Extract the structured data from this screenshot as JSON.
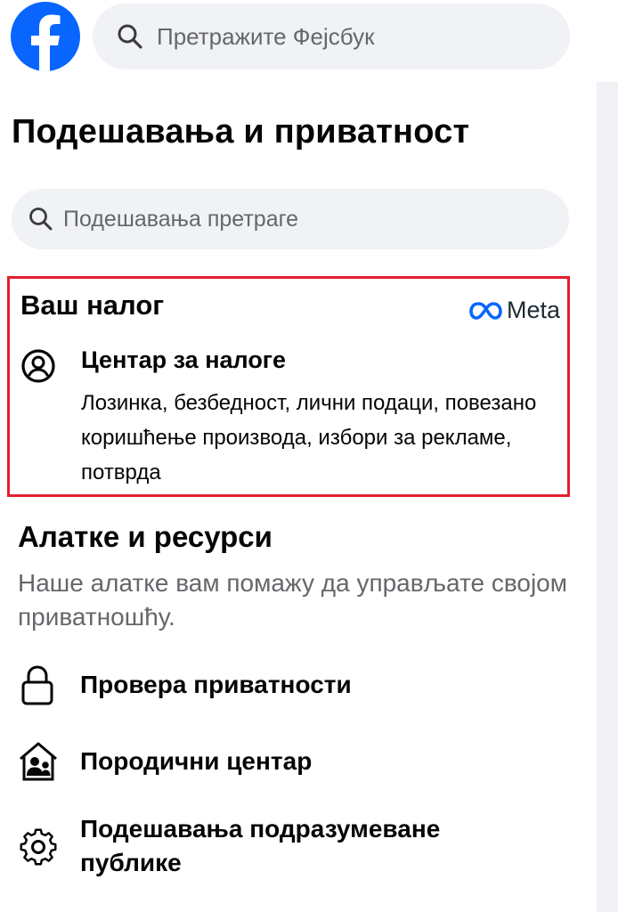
{
  "header": {
    "search_placeholder": "Претражите Фејсбук"
  },
  "page": {
    "title": "Подешавања и приватност",
    "settings_search_placeholder": "Подешавања претраге"
  },
  "account_section": {
    "heading": "Ваш налог",
    "brand": "Meta",
    "item": {
      "title": "Центар за налоге",
      "description": "Лозинка, безбедност, лични подаци, повезано коришћење производа, избори за рекламе, потврда"
    }
  },
  "tools_section": {
    "heading": "Алатке и ресурси",
    "description": "Наше алатке вам помажу да управљате својом приватношћу.",
    "items": [
      {
        "label": "Провера приватности",
        "icon": "lock-icon"
      },
      {
        "label": "Породични центар",
        "icon": "family-home-icon"
      },
      {
        "label": "Подешавања подразумеване публике",
        "icon": "gear-icon"
      }
    ]
  },
  "colors": {
    "brand_blue": "#0866ff",
    "highlight_border": "#e41e2f",
    "secondary_text": "#65676b",
    "background": "#f0f2f5"
  }
}
